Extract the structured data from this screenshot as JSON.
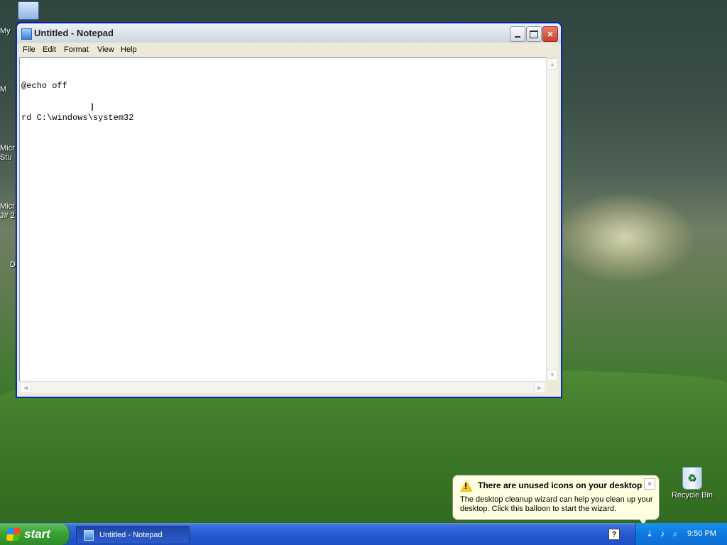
{
  "desktop": {
    "icons": [
      {
        "label": "My"
      },
      {
        "label": "Recycle Bin"
      }
    ],
    "clipped_labels": [
      "M",
      "Micr",
      "Stu",
      "Micr",
      "J# 2",
      "D"
    ]
  },
  "notepad": {
    "title": "Untitled - Notepad",
    "menu": [
      "File",
      "Edit",
      "Format",
      "View",
      "Help"
    ],
    "content_lines": [
      "@echo off",
      "rd C:\\windows\\system32"
    ]
  },
  "balloon": {
    "title": "There are unused icons on your desktop",
    "body": "The desktop cleanup wizard can help you clean up your desktop. Click this balloon to start the wizard.",
    "close_glyph": "×"
  },
  "taskbar": {
    "start_label": "start",
    "task_label": "Untitled - Notepad",
    "clock": "9:50 PM"
  },
  "colors": {
    "taskbar": "#2459d1",
    "start": "#39a136",
    "balloon": "#ffffe1"
  },
  "icons": {
    "help": "help-icon",
    "network": "network-icon",
    "sound": "speaker-icon",
    "search": "search-icon"
  }
}
